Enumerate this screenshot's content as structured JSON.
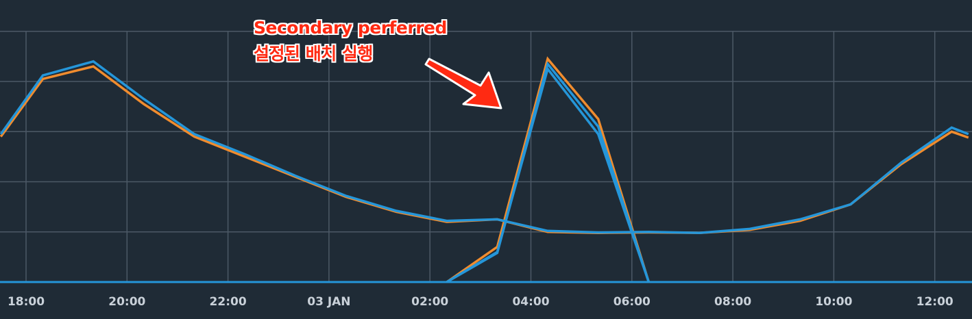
{
  "chart_data": {
    "type": "line",
    "x_ticks": [
      "18:00",
      "20:00",
      "22:00",
      "03 JAN",
      "02:00",
      "04:00",
      "06:00",
      "08:00",
      "10:00",
      "12:00"
    ],
    "ylim": [
      0,
      5
    ],
    "grid": true,
    "series": [
      {
        "color": "#f08c2e",
        "points": [
          [
            "17:30",
            2.9
          ],
          [
            "18:20",
            4.05
          ],
          [
            "19:20",
            4.3
          ],
          [
            "20:20",
            3.55
          ],
          [
            "21:20",
            2.9
          ],
          [
            "22:20",
            2.5
          ],
          [
            "23:20",
            2.1
          ],
          [
            "00:20",
            1.7
          ],
          [
            "01:20",
            1.4
          ],
          [
            "02:20",
            1.2
          ],
          [
            "03:20",
            1.25
          ],
          [
            "04:20",
            1.0
          ],
          [
            "05:20",
            0.98
          ],
          [
            "06:20",
            0.99
          ],
          [
            "07:20",
            0.98
          ],
          [
            "08:20",
            1.04
          ],
          [
            "09:20",
            1.22
          ],
          [
            "10:20",
            1.55
          ],
          [
            "11:20",
            2.35
          ],
          [
            "12:20",
            3.0
          ],
          [
            "12:40",
            2.88
          ]
        ]
      },
      {
        "color": "#f08c2e",
        "points": [
          [
            "02:20",
            0
          ],
          [
            "03:20",
            0.7
          ],
          [
            "04:20",
            4.45
          ],
          [
            "05:20",
            3.25
          ],
          [
            "06:20",
            0
          ]
        ]
      },
      {
        "color": "#2596d9",
        "points": [
          [
            "02:20",
            0
          ],
          [
            "03:20",
            0.6
          ],
          [
            "04:20",
            4.25
          ],
          [
            "05:20",
            2.95
          ],
          [
            "06:20",
            0
          ]
        ]
      },
      {
        "color": "#2596d9",
        "points": [
          [
            "17:30",
            2.95
          ],
          [
            "18:20",
            4.12
          ],
          [
            "19:20",
            4.4
          ],
          [
            "20:20",
            3.65
          ],
          [
            "21:20",
            2.95
          ],
          [
            "22:20",
            2.55
          ],
          [
            "23:20",
            2.12
          ],
          [
            "00:20",
            1.72
          ],
          [
            "01:20",
            1.42
          ],
          [
            "02:20",
            1.22
          ],
          [
            "03:20",
            1.25
          ],
          [
            "04:20",
            1.02
          ],
          [
            "05:20",
            0.99
          ],
          [
            "06:20",
            1.0
          ],
          [
            "07:20",
            0.98
          ],
          [
            "08:20",
            1.06
          ],
          [
            "09:20",
            1.25
          ],
          [
            "10:20",
            1.55
          ],
          [
            "11:20",
            2.38
          ],
          [
            "12:20",
            3.08
          ],
          [
            "12:40",
            2.95
          ]
        ]
      },
      {
        "color": "#2596d9",
        "points": [
          [
            "02:20",
            0
          ],
          [
            "03:20",
            0.58
          ],
          [
            "04:20",
            4.35
          ],
          [
            "05:20",
            3.1
          ],
          [
            "06:20",
            0
          ]
        ]
      }
    ],
    "annotation": {
      "lines": [
        "Secondary perferred",
        "설정된 배치 실행"
      ],
      "color": "#ff2a12"
    }
  }
}
